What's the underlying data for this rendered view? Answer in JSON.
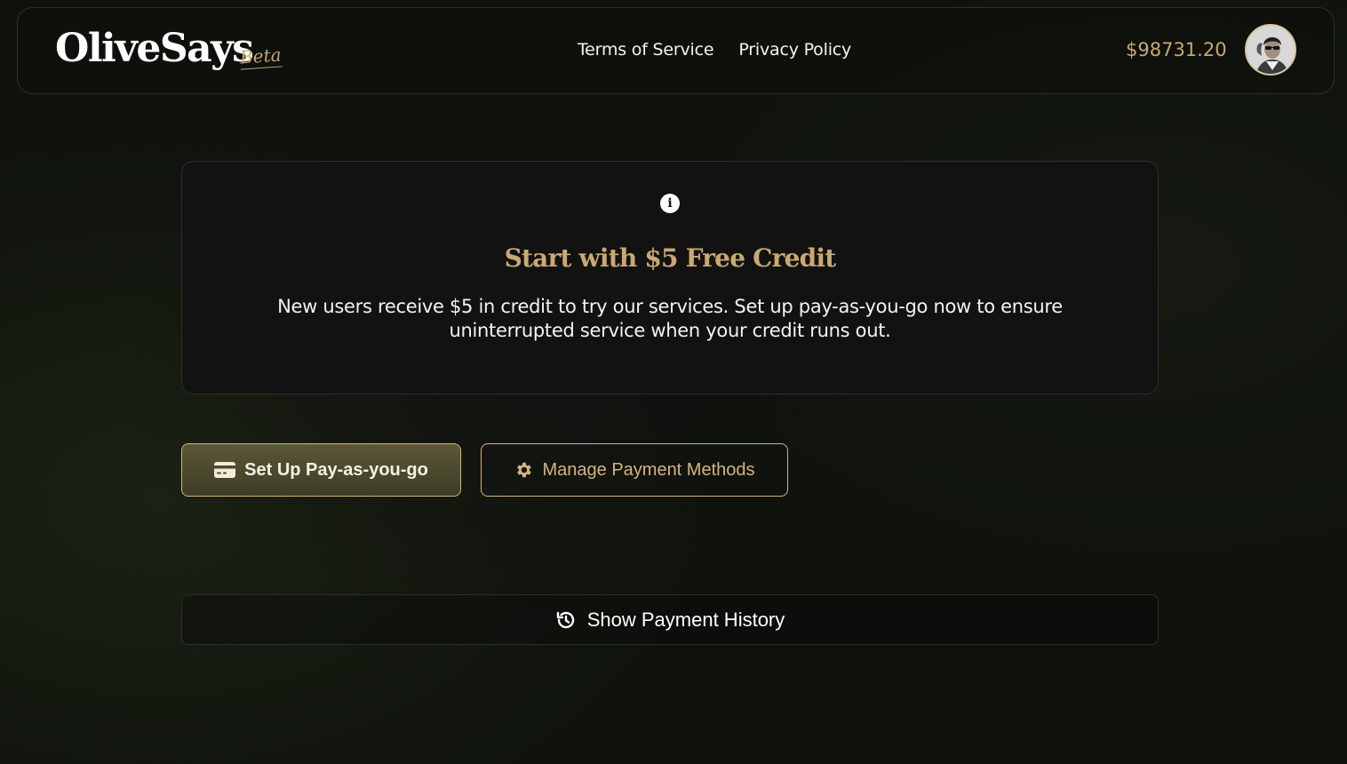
{
  "header": {
    "brand": "OliveSays",
    "badge": "Beta",
    "nav": [
      "Terms of Service",
      "Privacy Policy"
    ],
    "balance": "$98731.20"
  },
  "notice": {
    "icon": "info-icon",
    "title": "Start with $5 Free Credit",
    "body": "New users receive $5 in credit to try our services. Set up pay-as-you-go now to ensure uninterrupted service when your credit runs out."
  },
  "actions": {
    "setup_label": "Set Up Pay-as-you-go",
    "setup_icon": "credit-card-icon",
    "manage_label": "Manage Payment Methods",
    "manage_icon": "gear-icon"
  },
  "history": {
    "label": "Show Payment History",
    "icon": "history-icon"
  },
  "colors": {
    "accent": "#c9a872",
    "background": "#0f120d",
    "card": "#121212"
  }
}
